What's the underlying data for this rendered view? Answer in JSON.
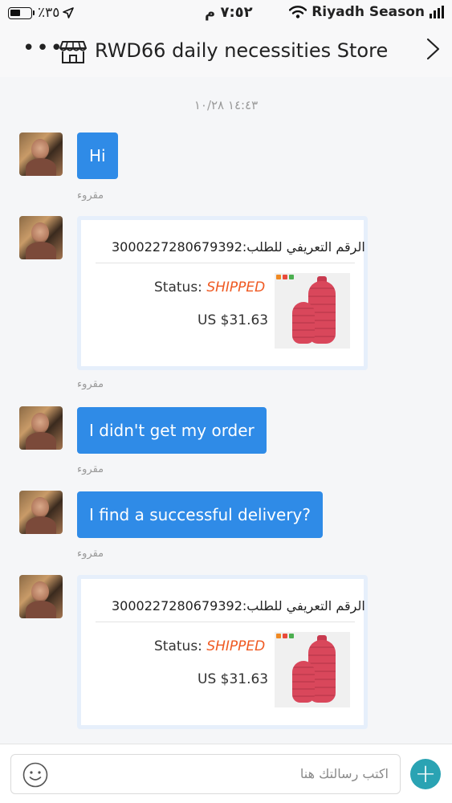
{
  "status_bar": {
    "battery_text": "٪٣٥",
    "time": "٧:٥٢ م",
    "carrier": "Riyadh Season"
  },
  "header": {
    "more_label": "•••",
    "title": "RWD66 daily necessities Store"
  },
  "chat": {
    "date": "١٤:٤٣ ١٠/٢٨",
    "read_label": "مقروء",
    "messages": [
      {
        "type": "text",
        "text": "Hi"
      },
      {
        "type": "order",
        "order_id": "الرقم التعريفي للطلب:3000227280679392",
        "status_label": "Status: ",
        "status_value": "SHIPPED",
        "price": "US $31.63"
      },
      {
        "type": "text",
        "text": "I didn't get my order"
      },
      {
        "type": "text",
        "text": "I find a successful delivery?"
      },
      {
        "type": "order",
        "order_id": "الرقم التعريفي للطلب:3000227280679392",
        "status_label": "Status: ",
        "status_value": "SHIPPED",
        "price": "US $31.63"
      }
    ]
  },
  "input": {
    "placeholder": "اكتب رسالتك هنا",
    "plus_label": "+"
  },
  "colors": {
    "bubble": "#2f8be7",
    "status_shipped": "#ef5a23",
    "plus_button": "#2aa3b3"
  }
}
